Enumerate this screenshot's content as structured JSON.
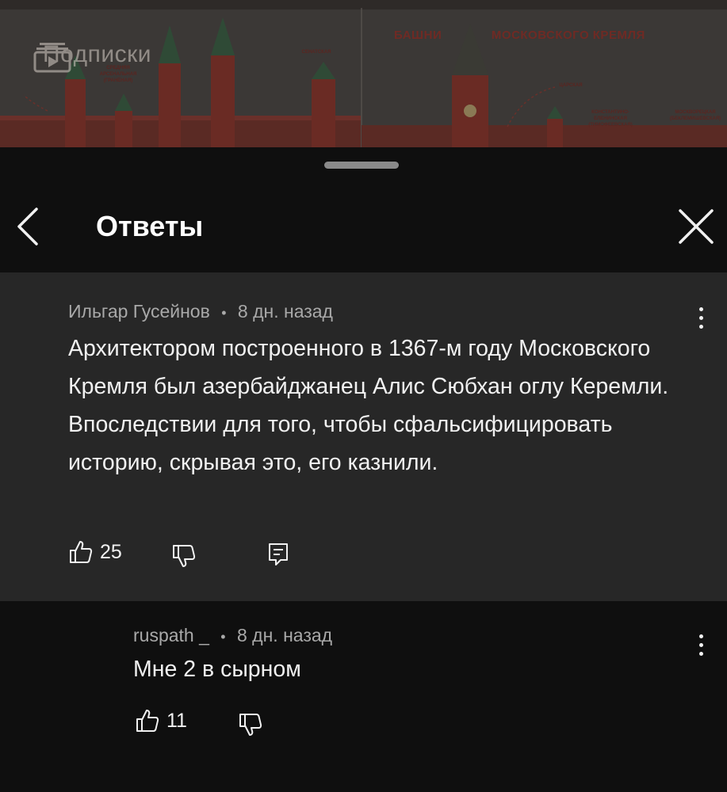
{
  "video": {
    "subscribe_label": "Подписки",
    "poster_title_1": "БАШНИ",
    "poster_title_2": "МОСКОВСКОГО КРЕМЛЯ",
    "tower_labels": {
      "left": "СРЕДНЯЯ АРСЕНАЛЬНАЯ (ГРАНЁНАЯ)",
      "senate": "СЕНАТСКАЯ",
      "tsar": "ЦАРСКАЯ",
      "konstantin": "КОНСТАНТИНО-ЕЛЕНИНСКАЯ (ТИМОФЕЕВСКАЯ)",
      "far_right": "МОСКВОРЕЦКАЯ (БЕКЛЕМИШЕВСКАЯ)"
    }
  },
  "header": {
    "title": "Ответы"
  },
  "parent_comment": {
    "author": "Ильгар Гусейнов",
    "separator": "•",
    "time": "8 дн. назад",
    "text": "Архитектором построенного в 1367-м году Московского Кремля был азербайджанец Алис Сюбхан оглу Керемли. Впоследствии для того, чтобы сфальсифицировать историю, скрывая это, его казнили.",
    "likes": "25"
  },
  "reply": {
    "author": "ruspath _",
    "separator": "•",
    "time": "8 дн. назад",
    "text": "Мне 2 в сырном",
    "likes": "11"
  },
  "colors": {
    "background": "#0f0f0f",
    "comment_highlight": "#272727",
    "meta_text": "#a9a9a9",
    "kremlin_red": "#7a2a22"
  }
}
